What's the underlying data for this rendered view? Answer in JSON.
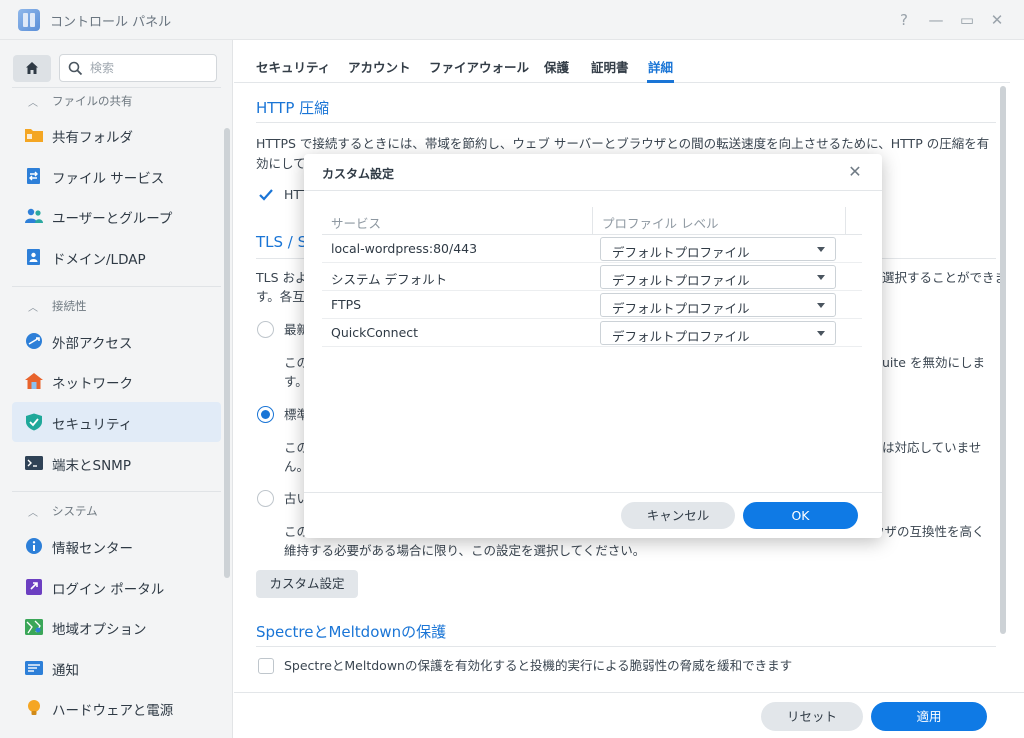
{
  "window": {
    "title": "コントロール パネル",
    "help": "?",
    "minimize": "—",
    "maximize": "▭",
    "close": "✕"
  },
  "sidebar": {
    "search_placeholder": "検索",
    "sections": [
      {
        "title": "ファイルの共有",
        "items": [
          "共有フォルダ",
          "ファイル サービス",
          "ユーザーとグループ",
          "ドメイン/LDAP"
        ]
      },
      {
        "title": "接続性",
        "items": [
          "外部アクセス",
          "ネットワーク",
          "セキュリティ",
          "端末とSNMP"
        ]
      },
      {
        "title": "システム",
        "items": [
          "情報センター",
          "ログイン ポータル",
          "地域オプション",
          "通知",
          "ハードウェアと電源"
        ]
      }
    ],
    "active_item": "セキュリティ"
  },
  "tabs": [
    "セキュリティ",
    "アカウント",
    "ファイアウォール",
    "保護",
    "証明書",
    "詳細"
  ],
  "active_tab": "詳細",
  "http": {
    "title": "HTTP 圧縮",
    "desc1": "HTTPS で接続するときには、帯域を節約し、ウェブ サーバーとブラウザとの間の転送速度を向上させるために、HTTP の圧縮を有",
    "desc2": "効にして",
    "checkbox_label": "HTT"
  },
  "tls": {
    "title": "TLS / S",
    "desc1_left": "TLS およ",
    "desc1_right": "選択することができま",
    "desc2": "す。各互",
    "option1": "最新",
    "option1_desc1_left": "この",
    "option1_desc1_right": "uite を無効にしま",
    "option1_desc2": "す。",
    "option2": "標準",
    "option2_desc1_left": "この",
    "option2_desc1_right": "は対応していませ",
    "option2_desc2": "ん。",
    "option3": "古い",
    "option3_desc1_left": "この",
    "option3_desc1_right": "ウザの互換性を高く",
    "option3_desc2": "維持する必要がある場合に限り、この設定を選択してください。",
    "custom_button": "カスタム設定"
  },
  "spectre": {
    "title": "SpectreとMeltdownの保護",
    "checkbox_label": "SpectreとMeltdownの保護を有効化すると投機的実行による脆弱性の脅威を緩和できます"
  },
  "footer": {
    "reset": "リセット",
    "apply": "適用"
  },
  "modal": {
    "title": "カスタム設定",
    "close": "✕",
    "col_service": "サービス",
    "col_profile": "プロファイル レベル",
    "rows": [
      {
        "service": "local-wordpress:80/443",
        "profile": "デフォルトプロファイル"
      },
      {
        "service": "システム デフォルト",
        "profile": "デフォルトプロファイル"
      },
      {
        "service": "FTPS",
        "profile": "デフォルトプロファイル"
      },
      {
        "service": "QuickConnect",
        "profile": "デフォルトプロファイル"
      }
    ],
    "cancel": "キャンセル",
    "ok": "OK"
  },
  "colors": {
    "accent": "#1a75d6",
    "primary_button": "#0f7ae5",
    "sidebar_bg": "#f3f4f5",
    "active_bg": "#e1ebf7"
  }
}
